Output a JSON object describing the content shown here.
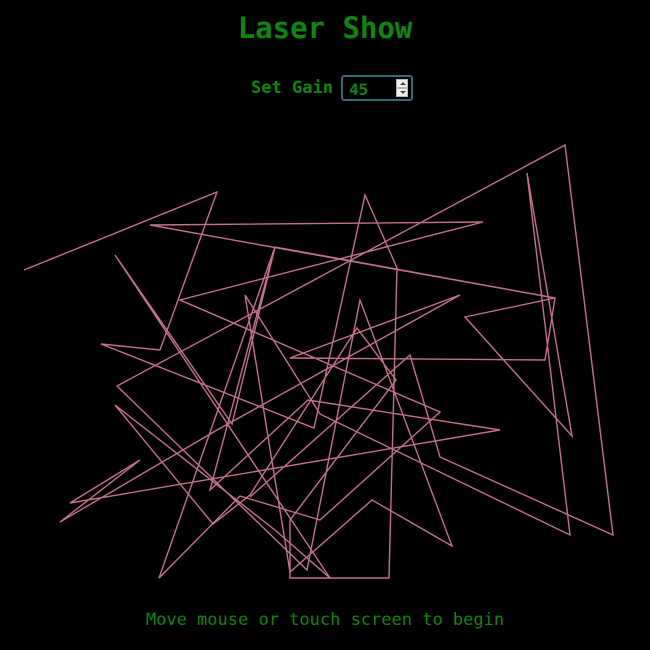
{
  "header": {
    "title": "Laser Show"
  },
  "controls": {
    "gain_label": "Set Gain",
    "gain_value": "45"
  },
  "footer": {
    "hint": "Move mouse or touch screen to begin"
  },
  "colors": {
    "background": "#000000",
    "text": "#0a8a0a",
    "laser": "#c8708a",
    "input_border": "#2a6e6e"
  }
}
